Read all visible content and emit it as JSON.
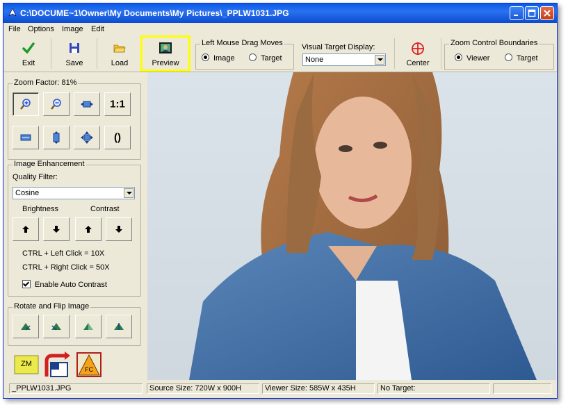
{
  "window": {
    "title": "C:\\DOCUME~1\\Owner\\My Documents\\My Pictures\\_PPLW1031.JPG"
  },
  "menu": [
    "File",
    "Options",
    "Image",
    "Edit"
  ],
  "toolbar": {
    "exit_label": "Exit",
    "save_label": "Save",
    "load_label": "Load",
    "preview_label": "Preview",
    "center_label": "Center",
    "highlight_color": "#ffff00"
  },
  "drag_moves": {
    "title": "Left Mouse Drag Moves",
    "options": [
      "Image",
      "Target"
    ],
    "selected": "Image"
  },
  "visual_target": {
    "title": "Visual Target Display:",
    "value": "None"
  },
  "zoom_boundaries": {
    "title": "Zoom Control Boundaries",
    "options": [
      "Viewer",
      "Target"
    ],
    "selected": "Viewer"
  },
  "zoom": {
    "title": "Zoom Factor: 81%",
    "one_to_one": "1:1"
  },
  "enhancement": {
    "title": "Image Enhancement",
    "quality_label": "Quality Filter:",
    "quality_value": "Cosine",
    "brightness_label": "Brightness",
    "contrast_label": "Contrast",
    "hint1": "CTRL + Left Click = 10X",
    "hint2": "CTRL + Right Click = 50X",
    "auto_contrast_label": "Enable Auto Contrast",
    "auto_contrast_checked": true
  },
  "rotate": {
    "title": "Rotate and Flip Image"
  },
  "bottom_icons": {
    "zm_label": "ZM",
    "fc_label": "FC"
  },
  "status": {
    "filename": "_PPLW1031.JPG",
    "source_size": "Source Size: 720W x 900H",
    "viewer_size": "Viewer Size: 585W x 435H",
    "target": "No Target:",
    "extra": ""
  }
}
